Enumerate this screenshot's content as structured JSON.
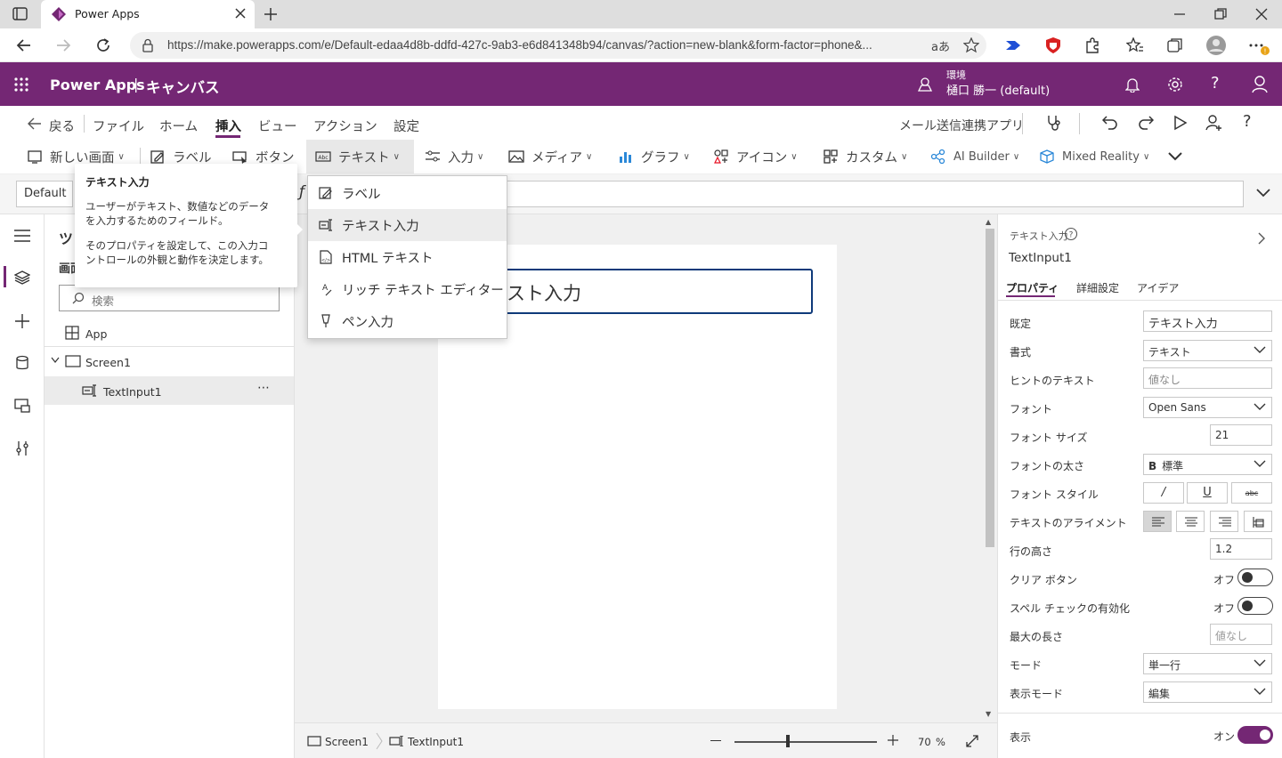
{
  "browser": {
    "tab_title": "Power Apps",
    "url": "https://make.powerapps.com/e/Default-edaa4d8b-ddfd-427c-9ab3-e6d841348b94/canvas/?action=new-blank&form-factor=phone&...",
    "read_aloud": "aあ"
  },
  "header": {
    "app_name": "Power Apps",
    "separator": "|",
    "title": "キャンバス",
    "env_label": "環境",
    "env_name": "樋口 勝一 (default)"
  },
  "menubar": {
    "back": "戻る",
    "items": [
      "ファイル",
      "ホーム",
      "挿入",
      "ビュー",
      "アクション",
      "設定"
    ],
    "active": "挿入",
    "app_title": "メール送信連携アプリ"
  },
  "ribbon": {
    "items": [
      "新しい画面",
      "ラベル",
      "ボタン",
      "テキスト",
      "入力",
      "メディア",
      "グラフ",
      "アイコン",
      "カスタム",
      "AI Builder",
      "Mixed Reality"
    ]
  },
  "formula": {
    "property": "Default",
    "fx_glyph": "ƒ"
  },
  "tooltip": {
    "title": "テキスト入力",
    "line1": "ユーザーがテキスト、数値などのデータ",
    "line2": "を入力するためのフィールド。",
    "line3": "そのプロパティを設定して、この入力コ",
    "line4": "ントロールの外観と動作を決定します。"
  },
  "dropdown": {
    "items": [
      "ラベル",
      "テキスト入力",
      "HTML テキスト",
      "リッチ テキスト エディター",
      "ペン入力"
    ],
    "hovered": "テキスト入力"
  },
  "tree": {
    "header_partial": "ツ",
    "tab_partial": "画面",
    "search_placeholder": "検索",
    "app": "App",
    "screen": "Screen1",
    "control": "TextInput1",
    "more": "⋯"
  },
  "canvas": {
    "input_text": "テキスト入力",
    "input_visible": "スト入力",
    "zoom_value": "70",
    "zoom_unit": "%",
    "breadcrumb_screen": "Screen1",
    "breadcrumb_control": "TextInput1"
  },
  "properties": {
    "type_label": "テキスト入力",
    "control_name": "TextInput1",
    "tabs": [
      "プロパティ",
      "詳細設定",
      "アイデア"
    ],
    "active_tab": "プロパティ",
    "rows": {
      "default_label": "既定",
      "default_value": "テキスト入力",
      "format_label": "書式",
      "format_value": "テキスト",
      "hint_label": "ヒントのテキスト",
      "hint_value": "値なし",
      "font_label": "フォント",
      "font_value": "Open Sans",
      "size_label": "フォント サイズ",
      "size_value": "21",
      "weight_label": "フォントの太さ",
      "weight_prefix": "B",
      "weight_value": "標準",
      "style_label": "フォント スタイル",
      "style_italic": "/",
      "style_underline": "U",
      "style_strike": "abc",
      "align_label": "テキストのアライメント",
      "lineheight_label": "行の高さ",
      "lineheight_value": "1.2",
      "clear_label": "クリア ボタン",
      "clear_state": "オフ",
      "spell_label": "スペル チェックの有効化",
      "spell_state": "オフ",
      "maxlen_label": "最大の長さ",
      "maxlen_value": "値なし",
      "mode_label": "モード",
      "mode_value": "単一行",
      "display_label": "表示モード",
      "display_value": "編集",
      "visible_label": "表示",
      "visible_state": "オン"
    }
  },
  "colors": {
    "brand": "#742774",
    "accent_blue": "#0f3a7a"
  }
}
